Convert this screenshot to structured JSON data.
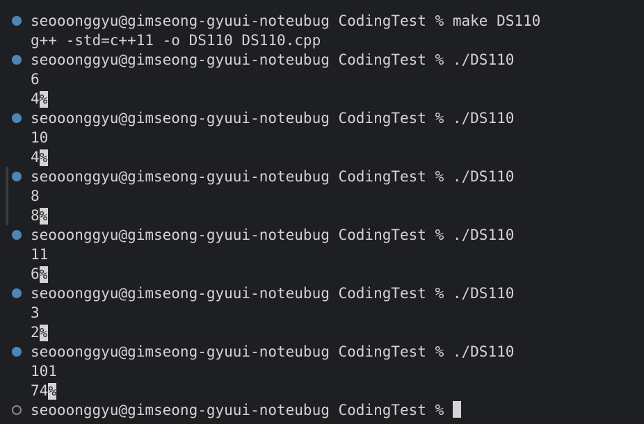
{
  "terminal": {
    "top_cut_text": "~~~",
    "lines": [
      {
        "kind": "prompt",
        "status": "done",
        "text": "seooonggyu@gimseong-gyuui-noteubug CodingTest % make DS110"
      },
      {
        "kind": "output",
        "text": "g++ -std=c++11 -o DS110 DS110.cpp"
      },
      {
        "kind": "prompt",
        "status": "done",
        "text": "seooonggyu@gimseong-gyuui-noteubug CodingTest % ./DS110"
      },
      {
        "kind": "output",
        "text": "6"
      },
      {
        "kind": "output",
        "text": "4",
        "eol": "%"
      },
      {
        "kind": "prompt",
        "status": "done",
        "text": "seooonggyu@gimseong-gyuui-noteubug CodingTest % ./DS110"
      },
      {
        "kind": "output",
        "text": "10"
      },
      {
        "kind": "output",
        "text": "4",
        "eol": "%"
      },
      {
        "kind": "prompt",
        "status": "done",
        "text": "seooonggyu@gimseong-gyuui-noteubug CodingTest % ./DS110"
      },
      {
        "kind": "output",
        "text": "8"
      },
      {
        "kind": "output",
        "text": "8",
        "eol": "%"
      },
      {
        "kind": "prompt",
        "status": "done",
        "text": "seooonggyu@gimseong-gyuui-noteubug CodingTest % ./DS110"
      },
      {
        "kind": "output",
        "text": "11"
      },
      {
        "kind": "output",
        "text": "6",
        "eol": "%"
      },
      {
        "kind": "prompt",
        "status": "done",
        "text": "seooonggyu@gimseong-gyuui-noteubug CodingTest % ./DS110"
      },
      {
        "kind": "output",
        "text": "3"
      },
      {
        "kind": "output",
        "text": "2",
        "eol": "%"
      },
      {
        "kind": "prompt",
        "status": "done",
        "text": "seooonggyu@gimseong-gyuui-noteubug CodingTest % ./DS110"
      },
      {
        "kind": "output",
        "text": "101"
      },
      {
        "kind": "output",
        "text": "74",
        "eol": "%"
      },
      {
        "kind": "prompt",
        "status": "pending",
        "text": "seooonggyu@gimseong-gyuui-noteubug CodingTest % ",
        "cursor": true
      }
    ]
  },
  "colors": {
    "background": "#1e1f22",
    "text": "#d4d4d4",
    "decoration_done": "#4d86b5",
    "decoration_pending": "#8a8a8a"
  }
}
